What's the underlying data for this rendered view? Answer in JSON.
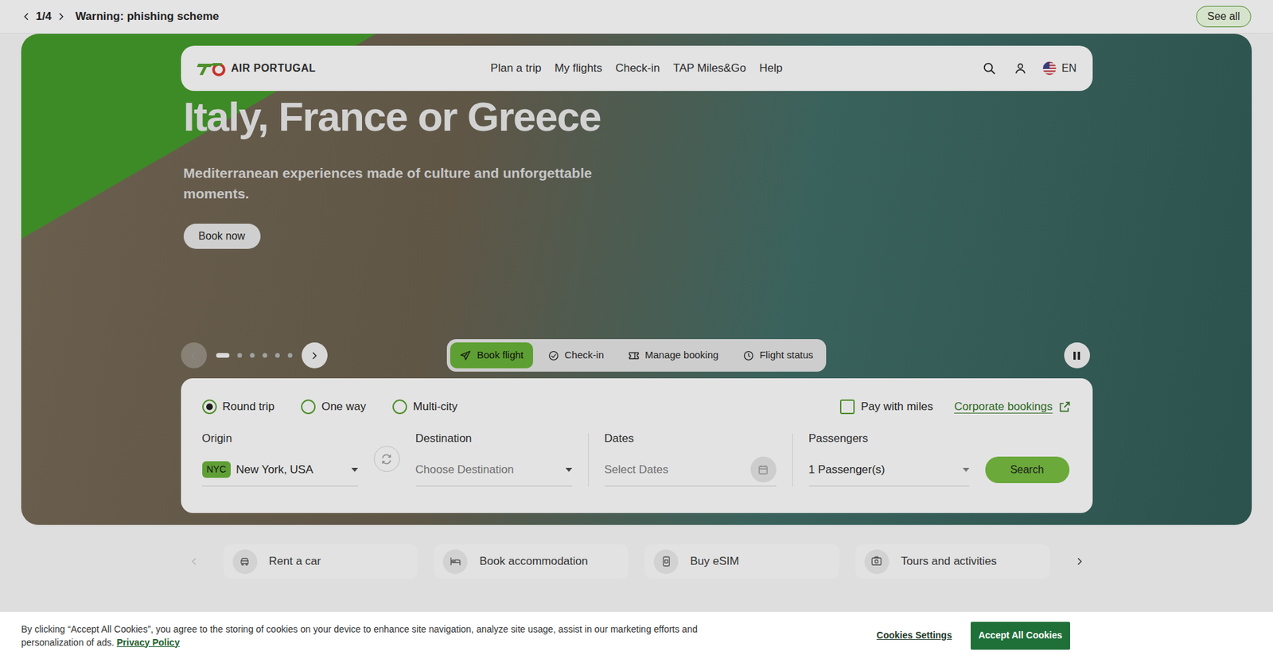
{
  "alert_bar": {
    "counter": "1/4",
    "message": "Warning: phishing scheme",
    "see_all": "See all"
  },
  "navbar": {
    "logo_text": "AIR PORTUGAL",
    "links": [
      "Plan a trip",
      "My flights",
      "Check-in",
      "TAP Miles&Go",
      "Help"
    ],
    "language": "EN"
  },
  "hero": {
    "title": "Italy, France or Greece",
    "subtitle": "Mediterranean experiences made of culture and unforgettable moments.",
    "cta": "Book now"
  },
  "carousel": {
    "prev_disabled": true,
    "playing": true,
    "slides": [
      {
        "selected": true
      },
      {
        "selected": false
      },
      {
        "selected": false
      },
      {
        "selected": false
      },
      {
        "selected": false
      },
      {
        "selected": false
      }
    ]
  },
  "booking_tabs": [
    {
      "label": "Book flight",
      "kind": "plane",
      "selected": true
    },
    {
      "label": "Check-in",
      "kind": "check",
      "selected": false
    },
    {
      "label": "Manage booking",
      "kind": "ticket",
      "selected": false
    },
    {
      "label": "Flight status",
      "kind": "clock",
      "selected": false
    }
  ],
  "booking": {
    "trip_types": [
      {
        "label": "Round trip",
        "selected": true
      },
      {
        "label": "One way",
        "selected": false
      },
      {
        "label": "Multi-city",
        "selected": false
      }
    ],
    "pay_with_miles": {
      "label": "Pay with miles",
      "checked": false
    },
    "corporate_link": "Corporate bookings",
    "origin": {
      "label": "Origin",
      "code": "NYC",
      "value": "New York, USA"
    },
    "destination": {
      "label": "Destination",
      "placeholder": "Choose Destination"
    },
    "dates": {
      "label": "Dates",
      "placeholder": "Select Dates"
    },
    "passengers": {
      "label": "Passengers",
      "value": "1 Passenger(s)"
    },
    "search": "Search"
  },
  "quick_links": {
    "prev_disabled": true,
    "items": [
      {
        "label": "Rent a car",
        "kind": "car"
      },
      {
        "label": "Book accommodation",
        "kind": "bed"
      },
      {
        "label": "Buy eSIM",
        "kind": "esim"
      },
      {
        "label": "Tours and activities",
        "kind": "tour"
      }
    ]
  },
  "cookie_banner": {
    "text": "By clicking “Accept All Cookies”, you agree to the storing of cookies on your device to enhance site navigation, analyze site usage, assist in our marketing efforts and personalization of ads.",
    "privacy_link": "Privacy Policy",
    "settings": "Cookies Settings",
    "accept": "Accept All Cookies"
  }
}
